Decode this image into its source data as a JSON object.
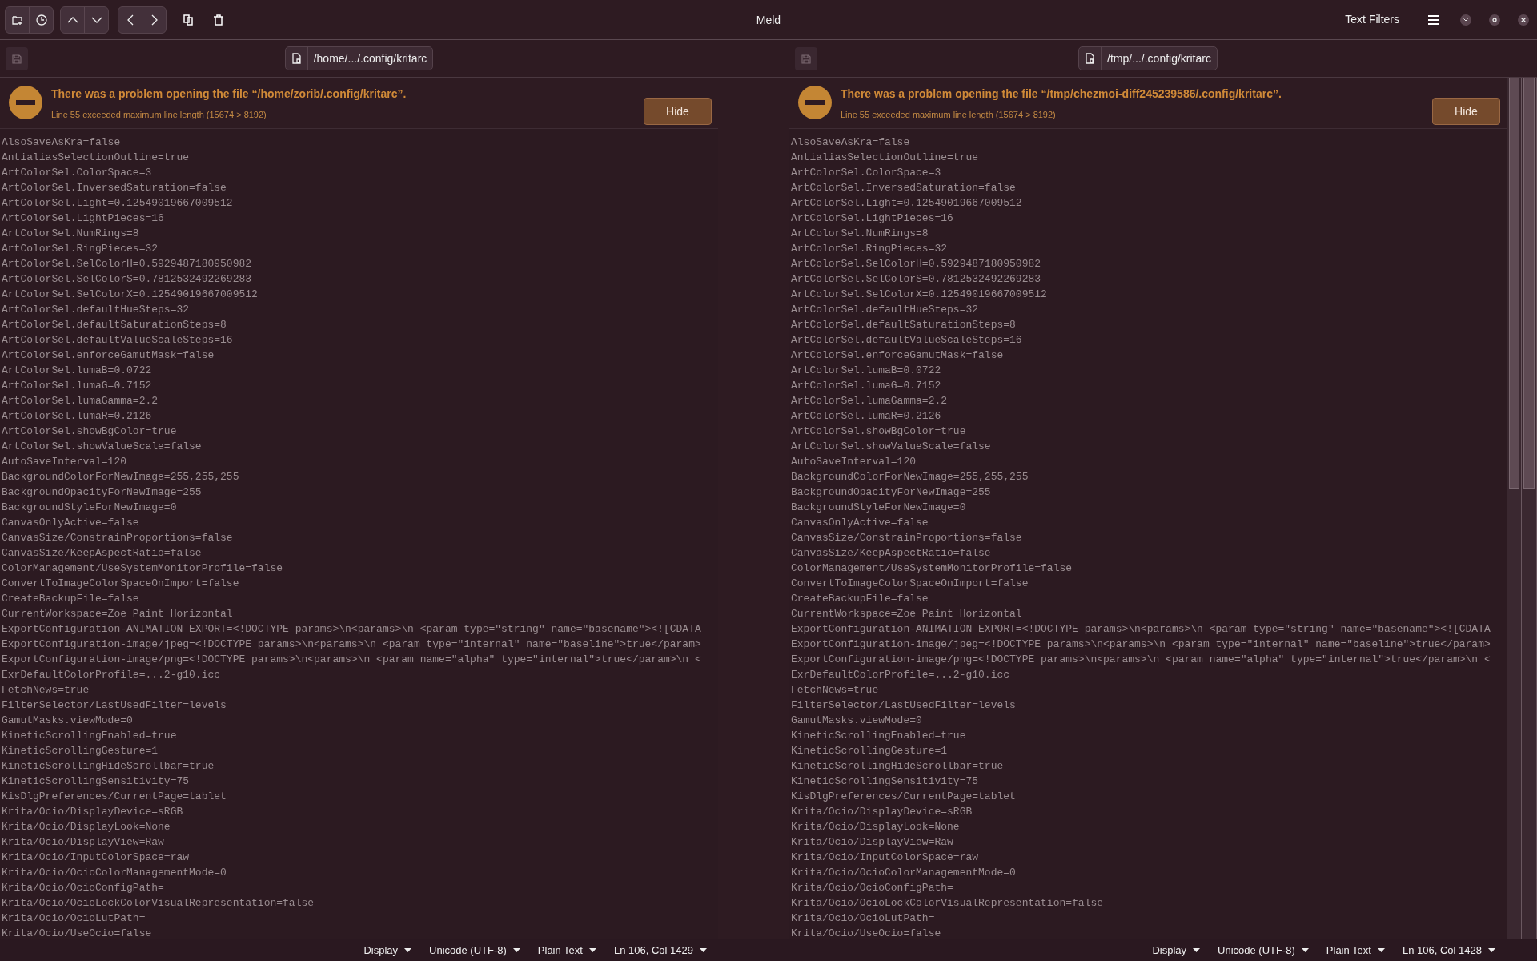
{
  "window": {
    "title": "Meld"
  },
  "header": {
    "filters_button": "Text Filters"
  },
  "panes": [
    {
      "file_path": "/home/.../.config/kritarc",
      "banner": {
        "title": "There was a problem opening the file “/home/zorib/.config/kritarc”.",
        "detail": "Line 55 exceeded maximum line length (15674 > 8192)",
        "button": "Hide"
      },
      "lines": [
        "AlsoSaveAsKra=false",
        "AntialiasSelectionOutline=true",
        "ArtColorSel.ColorSpace=3",
        "ArtColorSel.InversedSaturation=false",
        "ArtColorSel.Light=0.12549019667009512",
        "ArtColorSel.LightPieces=16",
        "ArtColorSel.NumRings=8",
        "ArtColorSel.RingPieces=32",
        "ArtColorSel.SelColorH=0.5929487180950982",
        "ArtColorSel.SelColorS=0.7812532492269283",
        "ArtColorSel.SelColorX=0.12549019667009512",
        "ArtColorSel.defaultHueSteps=32",
        "ArtColorSel.defaultSaturationSteps=8",
        "ArtColorSel.defaultValueScaleSteps=16",
        "ArtColorSel.enforceGamutMask=false",
        "ArtColorSel.lumaB=0.0722",
        "ArtColorSel.lumaG=0.7152",
        "ArtColorSel.lumaGamma=2.2",
        "ArtColorSel.lumaR=0.2126",
        "ArtColorSel.showBgColor=true",
        "ArtColorSel.showValueScale=false",
        "AutoSaveInterval=120",
        "BackgroundColorForNewImage=255,255,255",
        "BackgroundOpacityForNewImage=255",
        "BackgroundStyleForNewImage=0",
        "CanvasOnlyActive=false",
        "CanvasSize/ConstrainProportions=false",
        "CanvasSize/KeepAspectRatio=false",
        "ColorManagement/UseSystemMonitorProfile=false",
        "ConvertToImageColorSpaceOnImport=false",
        "CreateBackupFile=false",
        "CurrentWorkspace=Zoe Paint Horizontal",
        "ExportConfiguration-ANIMATION_EXPORT=<!DOCTYPE params>\\n<params>\\n <param type=\"string\" name=\"basename\"><![CDATA",
        "ExportConfiguration-image/jpeg=<!DOCTYPE params>\\n<params>\\n <param type=\"internal\" name=\"baseline\">true</param>",
        "ExportConfiguration-image/png=<!DOCTYPE params>\\n<params>\\n <param name=\"alpha\" type=\"internal\">true</param>\\n <",
        "ExrDefaultColorProfile=...2-g10.icc",
        "FetchNews=true",
        "FilterSelector/LastUsedFilter=levels",
        "GamutMasks.viewMode=0",
        "KineticScrollingEnabled=true",
        "KineticScrollingGesture=1",
        "KineticScrollingHideScrollbar=true",
        "KineticScrollingSensitivity=75",
        "KisDlgPreferences/CurrentPage=tablet",
        "Krita/Ocio/DisplayDevice=sRGB",
        "Krita/Ocio/DisplayLook=None",
        "Krita/Ocio/DisplayView=Raw",
        "Krita/Ocio/InputColorSpace=raw",
        "Krita/Ocio/OcioColorManagementMode=0",
        "Krita/Ocio/OcioConfigPath=",
        "Krita/Ocio/OcioLockColorVisualRepresentation=false",
        "Krita/Ocio/OcioLutPath=",
        "Krita/Ocio/UseOcio=false"
      ],
      "status": [
        "Display",
        "Unicode (UTF-8)",
        "Plain Text",
        "Ln 106, Col 1429"
      ]
    },
    {
      "file_path": "/tmp/.../.config/kritarc",
      "banner": {
        "title": "There was a problem opening the file “/tmp/chezmoi-diff245239586/.config/kritarc”.",
        "detail": "Line 55 exceeded maximum line length (15674 > 8192)",
        "button": "Hide"
      },
      "lines": [
        "AlsoSaveAsKra=false",
        "AntialiasSelectionOutline=true",
        "ArtColorSel.ColorSpace=3",
        "ArtColorSel.InversedSaturation=false",
        "ArtColorSel.Light=0.12549019667009512",
        "ArtColorSel.LightPieces=16",
        "ArtColorSel.NumRings=8",
        "ArtColorSel.RingPieces=32",
        "ArtColorSel.SelColorH=0.5929487180950982",
        "ArtColorSel.SelColorS=0.7812532492269283",
        "ArtColorSel.SelColorX=0.12549019667009512",
        "ArtColorSel.defaultHueSteps=32",
        "ArtColorSel.defaultSaturationSteps=8",
        "ArtColorSel.defaultValueScaleSteps=16",
        "ArtColorSel.enforceGamutMask=false",
        "ArtColorSel.lumaB=0.0722",
        "ArtColorSel.lumaG=0.7152",
        "ArtColorSel.lumaGamma=2.2",
        "ArtColorSel.lumaR=0.2126",
        "ArtColorSel.showBgColor=true",
        "ArtColorSel.showValueScale=false",
        "AutoSaveInterval=120",
        "BackgroundColorForNewImage=255,255,255",
        "BackgroundOpacityForNewImage=255",
        "BackgroundStyleForNewImage=0",
        "CanvasOnlyActive=false",
        "CanvasSize/ConstrainProportions=false",
        "CanvasSize/KeepAspectRatio=false",
        "ColorManagement/UseSystemMonitorProfile=false",
        "ConvertToImageColorSpaceOnImport=false",
        "CreateBackupFile=false",
        "CurrentWorkspace=Zoe Paint Horizontal",
        "ExportConfiguration-ANIMATION_EXPORT=<!DOCTYPE params>\\n<params>\\n <param type=\"string\" name=\"basename\"><![CDATA",
        "ExportConfiguration-image/jpeg=<!DOCTYPE params>\\n<params>\\n <param type=\"internal\" name=\"baseline\">true</param>",
        "ExportConfiguration-image/png=<!DOCTYPE params>\\n<params>\\n <param name=\"alpha\" type=\"internal\">true</param>\\n <",
        "ExrDefaultColorProfile=...2-g10.icc",
        "FetchNews=true",
        "FilterSelector/LastUsedFilter=levels",
        "GamutMasks.viewMode=0",
        "KineticScrollingEnabled=true",
        "KineticScrollingGesture=1",
        "KineticScrollingHideScrollbar=true",
        "KineticScrollingSensitivity=75",
        "KisDlgPreferences/CurrentPage=tablet",
        "Krita/Ocio/DisplayDevice=sRGB",
        "Krita/Ocio/DisplayLook=None",
        "Krita/Ocio/DisplayView=Raw",
        "Krita/Ocio/InputColorSpace=raw",
        "Krita/Ocio/OcioColorManagementMode=0",
        "Krita/Ocio/OcioConfigPath=",
        "Krita/Ocio/OcioLockColorVisualRepresentation=false",
        "Krita/Ocio/OcioLutPath=",
        "Krita/Ocio/UseOcio=false"
      ],
      "status": [
        "Display",
        "Unicode (UTF-8)",
        "Plain Text",
        "Ln 106, Col 1428"
      ]
    }
  ]
}
